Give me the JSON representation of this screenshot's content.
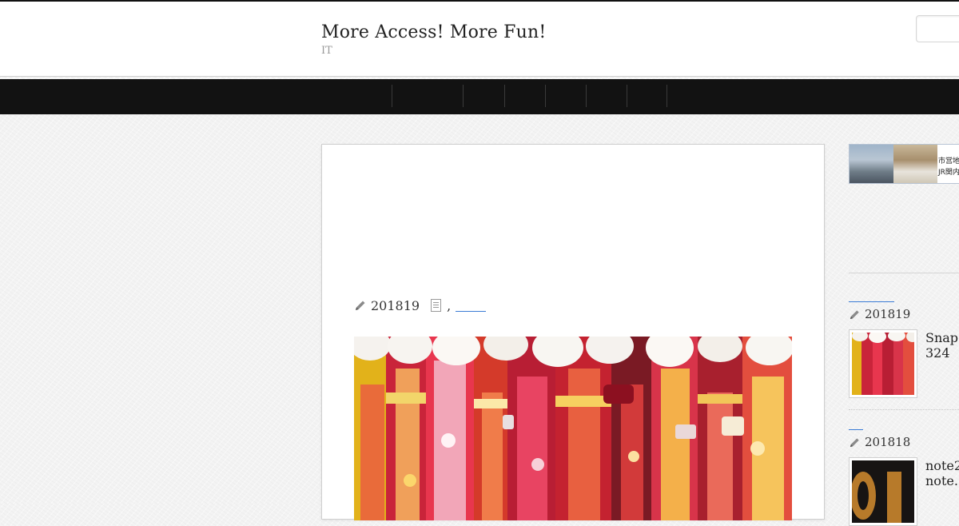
{
  "header": {
    "site_title": "More Access! More Fun!",
    "site_description": "IT"
  },
  "search": {
    "placeholder": ""
  },
  "nav": {
    "items": [
      "",
      "",
      "",
      "",
      "",
      ""
    ]
  },
  "article": {
    "date": "201819",
    "comma": ",",
    "category_link": "",
    "image_alt": "furisode"
  },
  "sidebar": {
    "ad": {
      "line1": "市営地下",
      "line2": "JR関内"
    },
    "recent_posts": [
      {
        "date": "201819",
        "title_line1": "Snap",
        "title_line2": "324"
      },
      {
        "date": "201818",
        "title_line1": "note2",
        "title_line2": "note."
      }
    ]
  },
  "colors": {
    "nav_background": "#121212",
    "link": "#3a7bd5",
    "page_background": "#f3f3f3"
  },
  "icons": [
    "pencil-icon",
    "document-icon"
  ]
}
